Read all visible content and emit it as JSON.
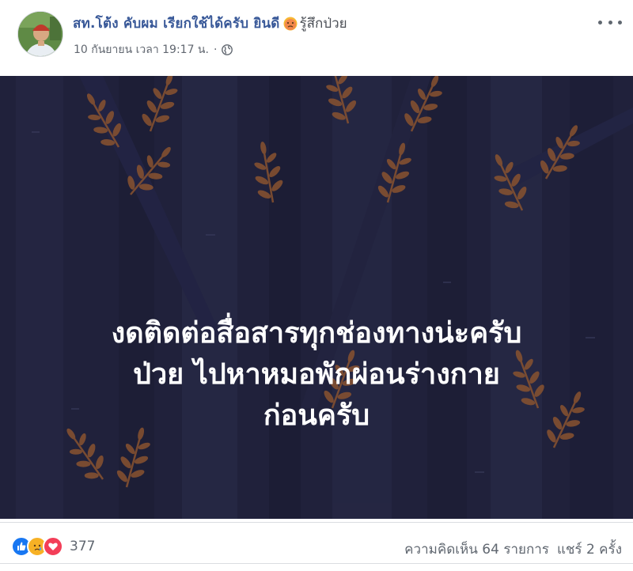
{
  "post": {
    "author": "สท.โต้ง คับผม เรียกใช้ได้ครับ ยินดี",
    "feeling_icon": "sick-face-emoji",
    "feeling": "รู้สึกป่วย",
    "timestamp": "10 กันยายน เวลา 19:17 น.",
    "separator": "·",
    "privacy_icon": "globe-icon",
    "more_icon": "more-options-icon"
  },
  "image": {
    "caption_lines": [
      "งดติดต่อสื่อสารทุกช่องทางน่ะครับ",
      "ป่วย ไปหาหมอพักผ่อนร่างกาย",
      "ก่อนครับ"
    ],
    "background_color": "#20213b",
    "leaf_color": "#8a5330"
  },
  "footer": {
    "reaction_icons": [
      "like-icon",
      "sad-icon",
      "love-icon"
    ],
    "reaction_count": "377",
    "comments": "ความคิดเห็น 64 รายการ",
    "shares": "แชร์ 2 ครั้ง"
  }
}
